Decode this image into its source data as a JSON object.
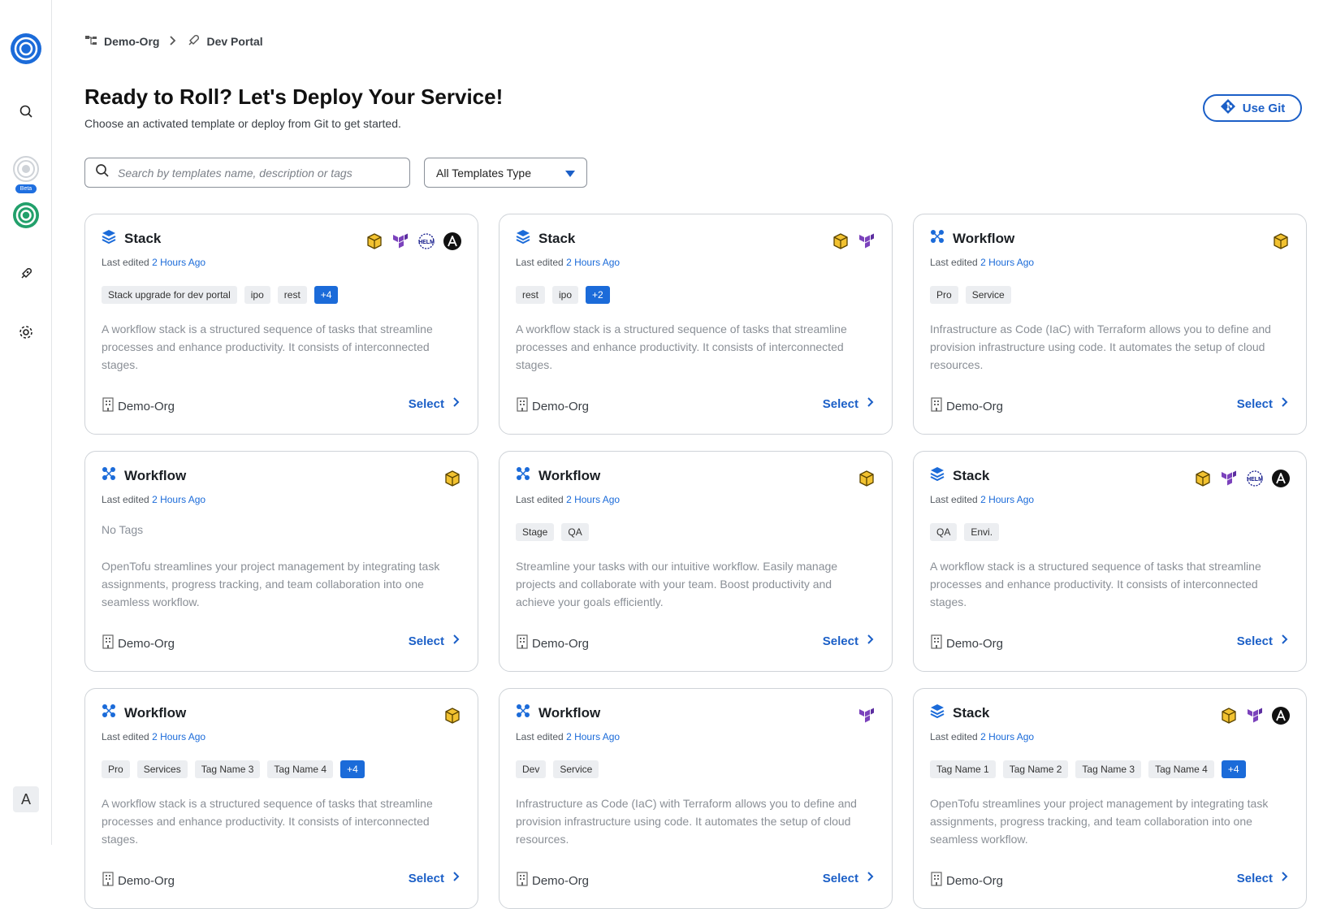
{
  "breadcrumb": {
    "org": "Demo-Org",
    "portal": "Dev Portal"
  },
  "header": {
    "title": "Ready to Roll? Let's Deploy Your Service!",
    "subtitle": "Choose an activated template or deploy from Git to get started.",
    "git_button": "Use Git"
  },
  "filters": {
    "search_placeholder": "Search by templates name, description or tags",
    "type_select": "All Templates Type"
  },
  "sidebar": {
    "beta_label": "Beta",
    "avatar_letter": "A"
  },
  "labels": {
    "last_edited": "Last edited",
    "select": "Select",
    "no_tags": "No Tags"
  },
  "colors": {
    "accent": "#1b5fc7",
    "tag_more": "#1b6bd9"
  },
  "cards": [
    {
      "type": "Stack",
      "tools": [
        "cube-icon",
        "terraform-icon",
        "helm-icon",
        "ansible-icon"
      ],
      "edited": "2 Hours Ago",
      "tags": [
        "Stack upgrade for dev portal",
        "ipo",
        "rest"
      ],
      "more": "+4",
      "desc": "A workflow stack is a structured sequence of tasks that streamline processes and enhance productivity. It consists of interconnected stages.",
      "org": "Demo-Org"
    },
    {
      "type": "Stack",
      "tools": [
        "cube-icon",
        "terraform-icon"
      ],
      "edited": "2 Hours Ago",
      "tags": [
        "rest",
        "ipo"
      ],
      "more": "+2",
      "desc": "A workflow stack is a structured sequence of tasks that streamline processes and enhance productivity. It consists of interconnected stages.",
      "org": "Demo-Org"
    },
    {
      "type": "Workflow",
      "tools": [
        "cube-icon"
      ],
      "edited": "2 Hours Ago",
      "tags": [
        "Pro",
        "Service"
      ],
      "more": "",
      "desc": "Infrastructure as Code (IaC) with Terraform allows you to define and provision infrastructure using code. It automates the setup of cloud resources.",
      "org": "Demo-Org"
    },
    {
      "type": "Workflow",
      "tools": [
        "cube-icon"
      ],
      "edited": "2 Hours Ago",
      "tags": [],
      "more": "",
      "desc": "OpenTofu streamlines your project management by integrating task assignments, progress tracking, and team collaboration into one seamless workflow.",
      "org": "Demo-Org"
    },
    {
      "type": "Workflow",
      "tools": [
        "cube-icon"
      ],
      "edited": "2 Hours Ago",
      "tags": [
        "Stage",
        "QA"
      ],
      "more": "",
      "desc": "Streamline your tasks with our intuitive workflow. Easily manage projects and collaborate with your team. Boost productivity and achieve your goals efficiently.",
      "org": "Demo-Org"
    },
    {
      "type": "Stack",
      "tools": [
        "cube-icon",
        "terraform-icon",
        "helm-icon",
        "ansible-icon"
      ],
      "edited": "2 Hours Ago",
      "tags": [
        "QA",
        "Envi."
      ],
      "more": "",
      "desc": "A workflow stack is a structured sequence of tasks that streamline processes and enhance productivity. It consists of interconnected stages.",
      "org": "Demo-Org"
    },
    {
      "type": "Workflow",
      "tools": [
        "cube-icon"
      ],
      "edited": "2 Hours Ago",
      "tags": [
        "Pro",
        "Services",
        "Tag Name 3",
        "Tag Name 4"
      ],
      "more": "+4",
      "desc": "A workflow stack is a structured sequence of tasks that streamline processes and enhance productivity. It consists of interconnected stages.",
      "org": "Demo-Org"
    },
    {
      "type": "Workflow",
      "tools": [
        "terraform-icon"
      ],
      "edited": "2 Hours Ago",
      "tags": [
        "Dev",
        "Service"
      ],
      "more": "",
      "desc": "Infrastructure as Code (IaC) with Terraform allows you to define and provision infrastructure using code. It automates the setup of cloud resources.",
      "org": "Demo-Org"
    },
    {
      "type": "Stack",
      "tools": [
        "cube-icon",
        "terraform-icon",
        "ansible-icon"
      ],
      "edited": "2 Hours Ago",
      "tags": [
        "Tag Name 1",
        "Tag Name 2",
        "Tag Name 3",
        "Tag Name 4"
      ],
      "more": "+4",
      "desc": "OpenTofu streamlines your project management by integrating task assignments, progress tracking, and team collaboration into one seamless workflow.",
      "org": "Demo-Org"
    }
  ]
}
